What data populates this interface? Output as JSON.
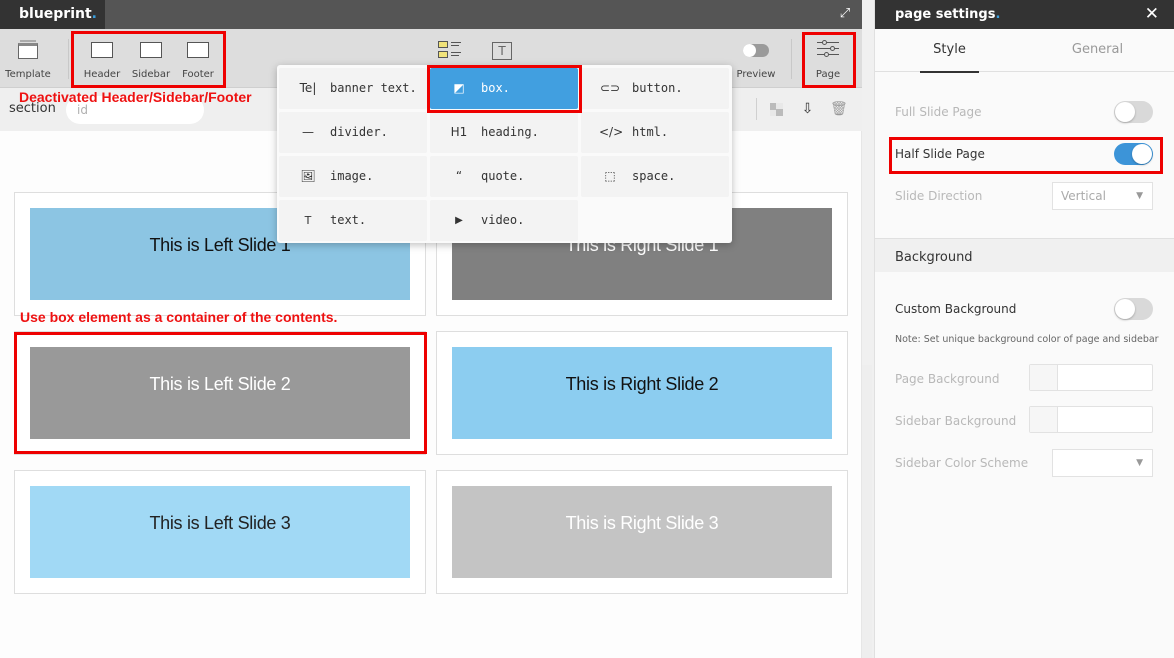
{
  "app": {
    "brand": "blueprint",
    "brand_dot": "."
  },
  "toolbar": {
    "template_label": "Template",
    "header_label": "Header",
    "sidebar_label": "Sidebar",
    "footer_label": "Footer",
    "preview_label": "Preview",
    "preview_enabled": false,
    "page_label": "Page"
  },
  "section_bar": {
    "label": "section",
    "id_placeholder": "id",
    "id_value": ""
  },
  "element_popup": {
    "selected": "box.",
    "items": [
      {
        "icon": "banner-text-icon",
        "glyph": "Te|",
        "label": "banner text."
      },
      {
        "icon": "box-icon",
        "glyph": "◩",
        "label": "box."
      },
      {
        "icon": "button-icon",
        "glyph": "⊂⊃",
        "label": "button."
      },
      {
        "icon": "divider-icon",
        "glyph": "—",
        "label": "divider."
      },
      {
        "icon": "heading-icon",
        "glyph": "H1",
        "label": "heading."
      },
      {
        "icon": "html-icon",
        "glyph": "</>",
        "label": "html."
      },
      {
        "icon": "image-icon",
        "glyph": "🖼",
        "label": "image."
      },
      {
        "icon": "quote-icon",
        "glyph": "“",
        "label": "quote."
      },
      {
        "icon": "space-icon",
        "glyph": "⬚",
        "label": "space."
      },
      {
        "icon": "text-icon",
        "glyph": "T",
        "label": "text."
      },
      {
        "icon": "video-icon",
        "glyph": "▶",
        "label": "video."
      }
    ]
  },
  "slides": [
    {
      "text": "This is Left Slide 1",
      "bg": "#8cc5e3",
      "color": "#111111"
    },
    {
      "text": "This is Right Slide 1",
      "bg": "#808080",
      "color": "#ffffff"
    },
    {
      "text": "This is Left Slide 2",
      "bg": "#999999",
      "color": "#ffffff"
    },
    {
      "text": "This is Right Slide 2",
      "bg": "#8ccdf0",
      "color": "#111111"
    },
    {
      "text": "This is Left Slide 3",
      "bg": "#a1d9f5",
      "color": "#222222"
    },
    {
      "text": "This is Right Slide 3",
      "bg": "#c4c4c4",
      "color": "#ffffff"
    }
  ],
  "annotations": {
    "deactivated": "Deactivated Header/Sidebar/Footer",
    "box_container": "Use box element as a container of the contents."
  },
  "panel": {
    "title": "page settings",
    "title_dot": ".",
    "tabs": [
      {
        "label": "Style",
        "active": true
      },
      {
        "label": "General",
        "active": false
      }
    ],
    "full_slide_page": {
      "label": "Full Slide Page",
      "enabled": false
    },
    "half_slide_page": {
      "label": "Half Slide Page",
      "enabled": true
    },
    "slide_direction": {
      "label": "Slide Direction",
      "value": "Vertical"
    },
    "background_section": "Background",
    "custom_background": {
      "label": "Custom Background",
      "enabled": false
    },
    "note": "Note: Set unique background color of page and sidebar",
    "page_background": {
      "label": "Page Background",
      "value": ""
    },
    "sidebar_background": {
      "label": "Sidebar Background",
      "value": ""
    },
    "sidebar_color_scheme": {
      "label": "Sidebar Color Scheme",
      "value": ""
    }
  },
  "colors": {
    "accent": "#419fe0",
    "toggle_on": "#3c94d8",
    "annotation": "#ee0000",
    "topbar": "#555555",
    "brand_tab": "#333333"
  }
}
